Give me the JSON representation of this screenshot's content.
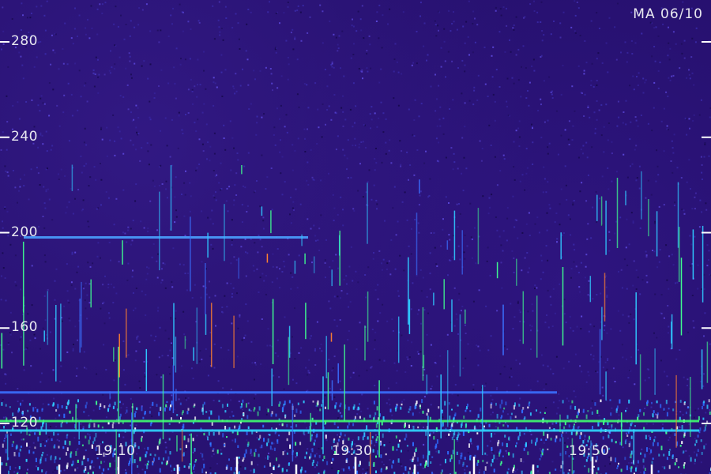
{
  "chart_data": {
    "type": "heatmap",
    "stamp": "MA 06/10",
    "y_ticks": [
      "280",
      "240",
      "200",
      "160",
      "120"
    ],
    "y_tick_values": [
      280,
      240,
      200,
      160,
      120
    ],
    "x_ticks": [
      "19:10",
      "19:30",
      "19:50"
    ],
    "ylim": [
      100,
      290
    ],
    "xlim": [
      "19:00",
      "19:59"
    ],
    "grid": false,
    "colors": {
      "background": "#26106e",
      "noise_light": "#4a3cc8",
      "line_cyan": "#30d8ff",
      "line_green": "#40ff70",
      "line_blue": "#3a70ff"
    },
    "horizontal_bands": [
      {
        "y": 198,
        "x_start": "19:02",
        "x_end": "19:26",
        "color": "#4aa0ff"
      },
      {
        "y": 133,
        "x_start": "19:00",
        "x_end": "19:47",
        "color": "#3a70ff"
      },
      {
        "y": 121,
        "x_start": "19:00",
        "x_end": "19:59",
        "color": "#40ff70"
      },
      {
        "y": 117,
        "x_start": "19:00",
        "x_end": "19:59",
        "color": "#30d8ff"
      }
    ]
  }
}
